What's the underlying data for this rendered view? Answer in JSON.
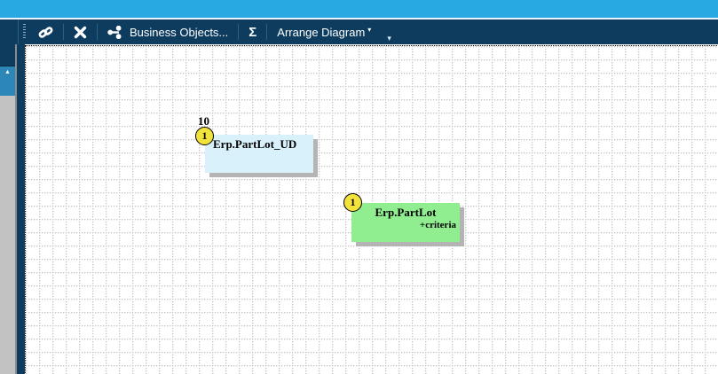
{
  "toolbar": {
    "business_objects_label": "Business Objects...",
    "sigma_label": "Σ",
    "arrange_diagram_label": "Arrange Diagram",
    "arrange_caret": "▾",
    "overflow_caret": "▾"
  },
  "sidebar": {
    "collapse_arrow": "▲"
  },
  "canvas": {
    "nodes": [
      {
        "title": "Erp.PartLot_UD",
        "badge": "1",
        "count": "10",
        "fill": "#d9f1fb"
      },
      {
        "title": "Erp.PartLot",
        "badge": "1",
        "criteria": "+criteria",
        "fill": "#90ee90"
      }
    ]
  },
  "colors": {
    "topbar_blue": "#29a9e1",
    "toolbar_navy": "#0d3c5f",
    "rail_gray": "#c2c2c2",
    "rail_button_blue": "#2c86b8",
    "badge_yellow": "#f2e23c",
    "node_blue": "#d9f1fb",
    "node_green": "#90ee90",
    "shadow_gray": "#b4b4b4",
    "grid_dot": "#c9c9c9"
  }
}
